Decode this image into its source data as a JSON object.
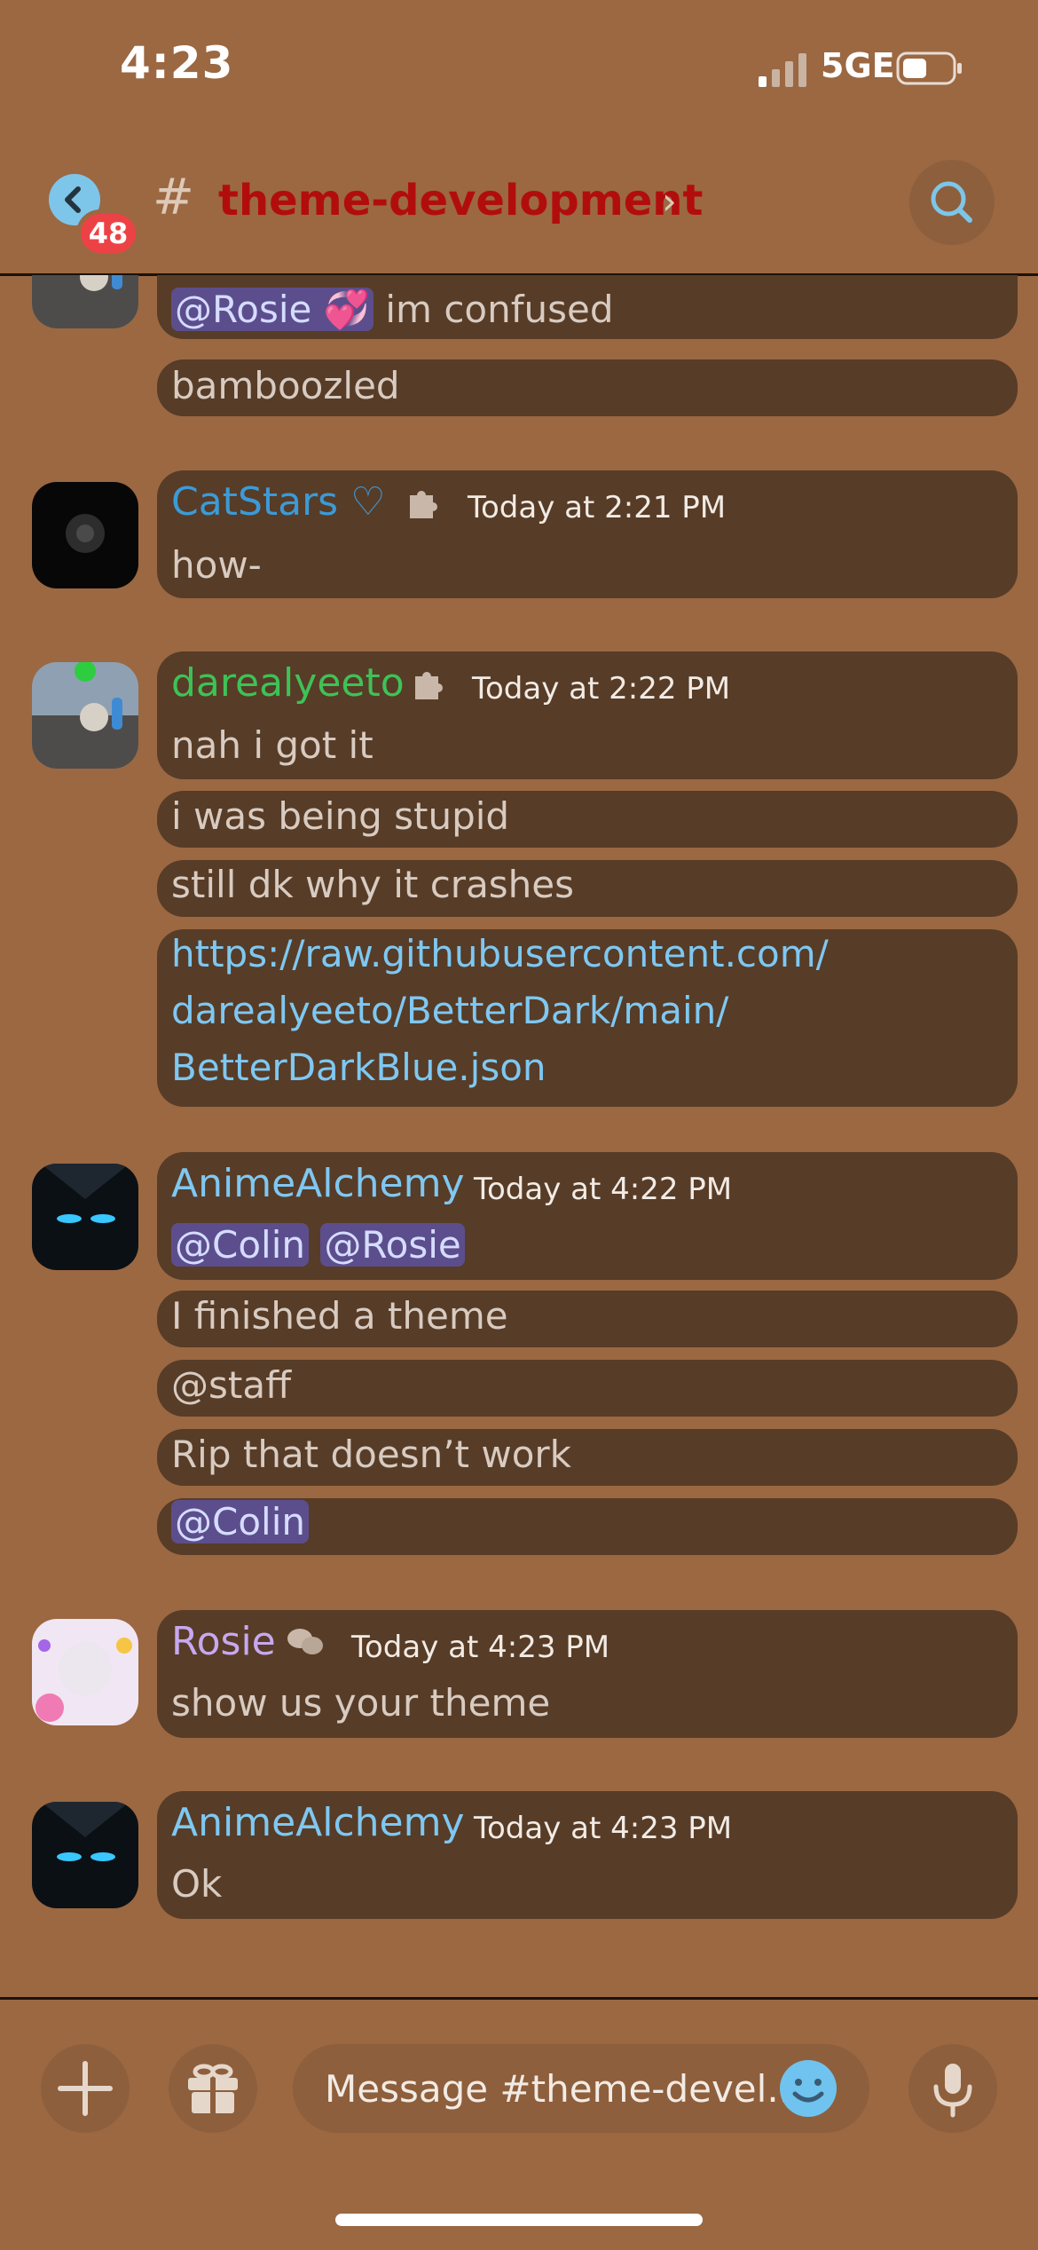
{
  "status_bar": {
    "time": "4:23",
    "network": "5GE"
  },
  "header": {
    "unread_count": "48",
    "channel_prefix": "#",
    "channel_name": "theme-development",
    "chevron": "›"
  },
  "messages": {
    "g0": {
      "lines": [
        {
          "mention": "@Rosie 💞",
          "text": "im confused"
        },
        {
          "text": "bamboozled"
        }
      ]
    },
    "g1": {
      "author": "CatStars ♡",
      "author_color": "#3b9bd8",
      "timestamp": "Today at 2:21 PM",
      "lines": [
        "how-"
      ]
    },
    "g2": {
      "author": "darealyeeto",
      "author_color": "#3ec257",
      "timestamp": "Today at 2:22 PM",
      "lines": [
        "nah i got it",
        "i was being stupid",
        "still dk why it crashes"
      ],
      "link": [
        "https://raw.githubusercontent.com/",
        "darealyeeto/BetterDark/main/",
        "BetterDarkBlue.json"
      ]
    },
    "g3": {
      "author": "AnimeAlchemy",
      "author_color": "#7ec8f2",
      "timestamp": "Today at 4:22 PM",
      "mentions": [
        "@Colin",
        "@Rosie"
      ],
      "lines": [
        "I finished a theme",
        "@staff",
        "Rip that doesn’t work"
      ],
      "last_mention": "@Colin"
    },
    "g4": {
      "author": "Rosie",
      "author_color": "#c7a8f0",
      "timestamp": "Today at 4:23 PM",
      "lines": [
        "show us your theme"
      ]
    },
    "g5": {
      "author": "AnimeAlchemy",
      "author_color": "#7ec8f2",
      "timestamp": "Today at 4:23 PM",
      "lines": [
        "Ok"
      ]
    }
  },
  "input": {
    "placeholder": "Message #theme-devel..."
  },
  "icons": [
    "back-arrow-icon",
    "search-icon",
    "puzzle-icon",
    "chat-bubbles-icon",
    "plus-icon",
    "gift-icon",
    "emoji-icon",
    "microphone-icon",
    "signal-icon",
    "battery-icon"
  ],
  "colors": {
    "background": "#9b6842",
    "bubble": "#573c27",
    "mention_bg": "#5c4e8c",
    "link": "#7ec8f2",
    "badge": "#ed4245",
    "channel_name": "#b20d0d"
  }
}
